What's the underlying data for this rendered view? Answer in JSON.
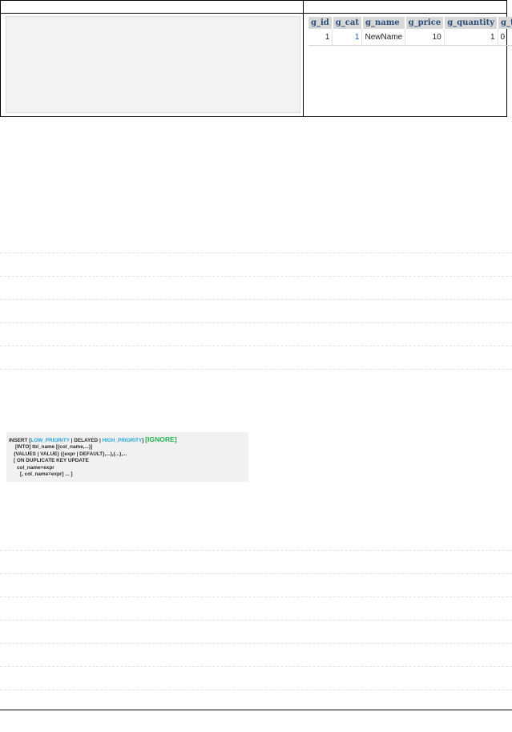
{
  "result_table": {
    "columns": [
      "g_id",
      "g_cat",
      "g_name",
      "g_price",
      "g_quantity",
      "g_top"
    ],
    "rows": [
      [
        "1",
        "1",
        "NewName",
        "10",
        "1",
        "0"
      ]
    ]
  },
  "syntax": {
    "line1": {
      "prefix": "INSERT [",
      "low_priority": "LOW_PRIORITY",
      "sep1": " | DELAYED | ",
      "high_priority": "HIGH_PRIORITY",
      "sep2": "] ",
      "ignore": "[IGNORE]"
    },
    "line2": "[INTO] tbl_name [(col_name,...)]",
    "line3": "{VALUES | VALUE} ({expr | DEFAULT},...),(...),...",
    "line4": "[ ON DUPLICATE KEY UPDATE",
    "line5": "col_name=expr",
    "line6": "[, col_name=expr] ... ]"
  },
  "colors": {
    "keyword_blue": "#26a3d8",
    "keyword_green": "#22b14c",
    "header_text": "#2a4d7a"
  }
}
